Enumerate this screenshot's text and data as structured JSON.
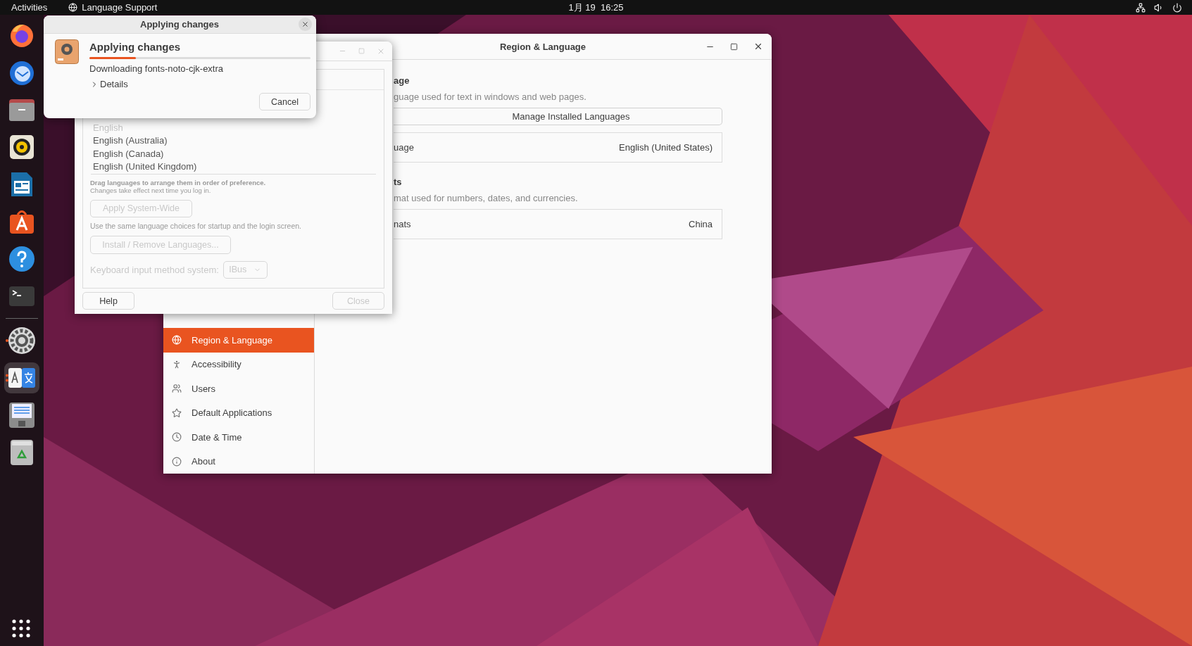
{
  "top_bar": {
    "activities": "Activities",
    "app_menu": "Language Support",
    "clock": "1月 19  16:25"
  },
  "dock": [
    {
      "running": false,
      "selected": false
    },
    {
      "running": false,
      "selected": false
    },
    {
      "running": false,
      "selected": false
    },
    {
      "running": false,
      "selected": false
    },
    {
      "running": false,
      "selected": false
    },
    {
      "running": false,
      "selected": false
    },
    {
      "running": false,
      "selected": false
    },
    {
      "running": false,
      "selected": false
    },
    {
      "running": true,
      "selected": false
    },
    {
      "running": true,
      "selected": true
    },
    {
      "running": false,
      "selected": false
    },
    {
      "running": false,
      "selected": false
    }
  ],
  "settings_window": {
    "title": "Region & Language",
    "sidebar": [
      {
        "label": "Region & Language",
        "selected": true
      },
      {
        "label": "Accessibility",
        "selected": false
      },
      {
        "label": "Users",
        "selected": false
      },
      {
        "label": "Default Applications",
        "selected": false
      },
      {
        "label": "Date & Time",
        "selected": false
      },
      {
        "label": "About",
        "selected": false
      }
    ],
    "sections": [
      {
        "heading": "age",
        "description": "guage used for text in windows and web pages.",
        "button": "Manage Installed Languages",
        "row": {
          "label": "uage",
          "value": "English (United States)"
        }
      },
      {
        "heading": "ts",
        "description": "mat used for numbers, dates, and currencies.",
        "row": {
          "label": "nats",
          "value": "China"
        }
      }
    ]
  },
  "language_support": {
    "languages": [
      {
        "label": "English",
        "dimmed": true
      },
      {
        "label": "English (Australia)",
        "dimmed": false
      },
      {
        "label": "English (Canada)",
        "dimmed": false
      },
      {
        "label": "English (United Kingdom)",
        "dimmed": false
      }
    ],
    "drag_hint": "Drag languages to arrange them in order of preference.",
    "drag_note": "Changes take effect next time you log in.",
    "apply_button": {
      "label": "Apply System-Wide",
      "disabled": true
    },
    "apply_note": "Use the same language choices for startup and the login screen.",
    "install_button": {
      "label": "Install / Remove Languages...",
      "disabled": true
    },
    "keyboard": {
      "label": "Keyboard input method system:",
      "value": "IBus",
      "disabled": true
    },
    "help_button": {
      "label": "Help",
      "disabled": false
    },
    "close_button": {
      "label": "Close",
      "disabled": true
    }
  },
  "applying_dialog": {
    "title": "Applying changes",
    "heading": "Applying changes",
    "progress": {
      "level": 0.21
    },
    "status": "Downloading fonts-noto-cjk-extra",
    "details": {
      "label": "Details",
      "expanded": false
    },
    "cancel": "Cancel"
  }
}
